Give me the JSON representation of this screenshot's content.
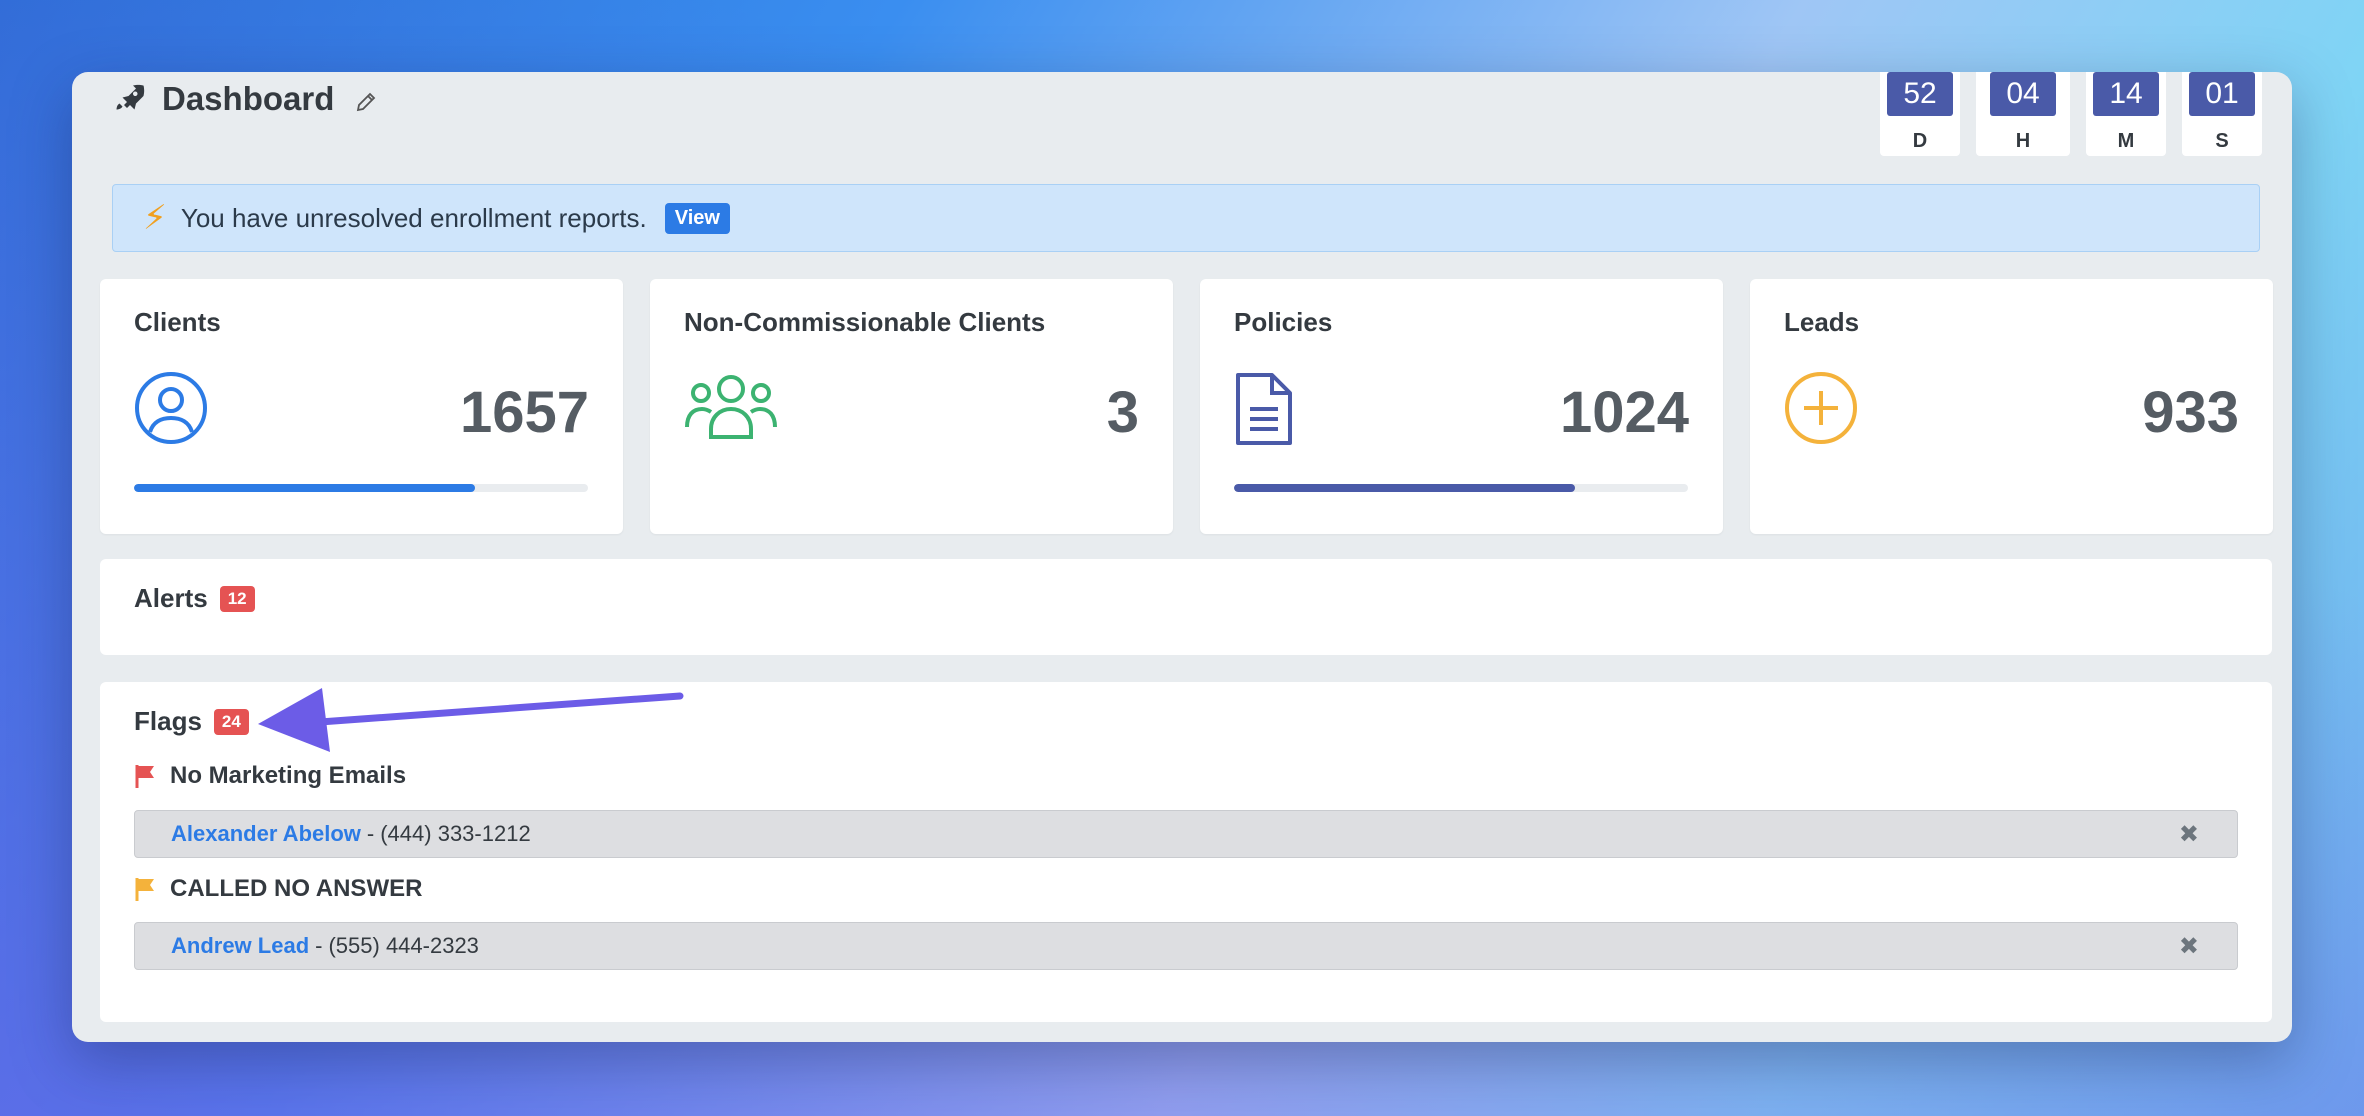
{
  "header": {
    "title": "Dashboard",
    "rocket_icon": "rocket-icon",
    "edit_icon": "pencil-icon"
  },
  "countdown": [
    {
      "value": "52",
      "label": "D"
    },
    {
      "value": "04",
      "label": "H"
    },
    {
      "value": "14",
      "label": "M"
    },
    {
      "value": "01",
      "label": "S"
    }
  ],
  "notice": {
    "text": "You have unresolved enrollment reports.",
    "button": "View",
    "icon": "bolt-icon"
  },
  "stats": [
    {
      "title": "Clients",
      "value": "1657",
      "icon": "user-circle-icon",
      "color": "#2c7be5",
      "progress": 0.75
    },
    {
      "title": "Non-Commissionable Clients",
      "value": "3",
      "icon": "users-group-icon",
      "color": "#3cb371",
      "progress": null
    },
    {
      "title": "Policies",
      "value": "1024",
      "icon": "document-icon",
      "color": "#4a5aa8",
      "progress": 0.75
    },
    {
      "title": "Leads",
      "value": "933",
      "icon": "plus-circle-icon",
      "color": "#f4b23b",
      "progress": null
    }
  ],
  "alerts": {
    "title": "Alerts",
    "count": "12"
  },
  "flags": {
    "title": "Flags",
    "count": "24",
    "groups": [
      {
        "title": "No Marketing Emails",
        "flag_color": "#e55353",
        "items": [
          {
            "name": "Alexander Abelow",
            "phone": "(444) 333-1212"
          }
        ]
      },
      {
        "title": "CALLED NO ANSWER",
        "flag_color": "#f4b23b",
        "items": [
          {
            "name": "Andrew Lead",
            "phone": "(555) 444-2323"
          }
        ]
      }
    ]
  },
  "colors": {
    "accent": "#2c7be5",
    "badge": "#e55353",
    "arrow": "#6c5ce7"
  }
}
